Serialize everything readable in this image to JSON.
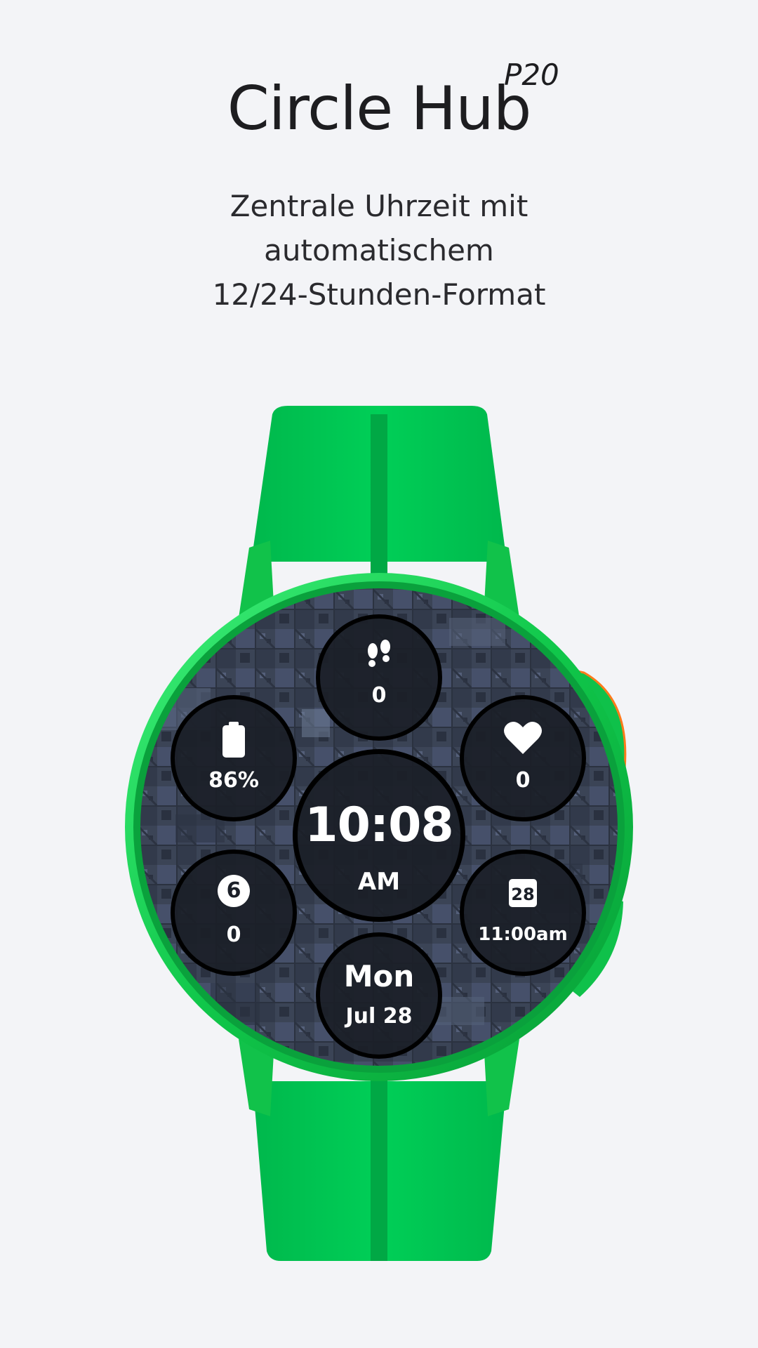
{
  "header": {
    "title": "Circle Hub",
    "title_sup": "P20",
    "subtitle_lines": [
      "Zentrale Uhrzeit mit",
      "automatischem",
      "12/24-Stunden-Format"
    ]
  },
  "watch": {
    "strap_color": "#00c853",
    "case_color": "#1ed760",
    "dial_color": "#3c4557",
    "complications": {
      "steps": {
        "icon": "footsteps-icon",
        "value": "0"
      },
      "battery": {
        "icon": "battery-icon",
        "value": "86%"
      },
      "heart_rate": {
        "icon": "heart-icon",
        "value": "0"
      },
      "time": {
        "value": "10:08",
        "period": "AM"
      },
      "notifications": {
        "icon": "badge-count-icon",
        "badge": "6",
        "value": "0"
      },
      "calendar": {
        "icon": "calendar-icon",
        "day_number": "28",
        "value": "11:00am"
      },
      "date": {
        "weekday": "Mon",
        "date": "Jul 28"
      }
    }
  }
}
